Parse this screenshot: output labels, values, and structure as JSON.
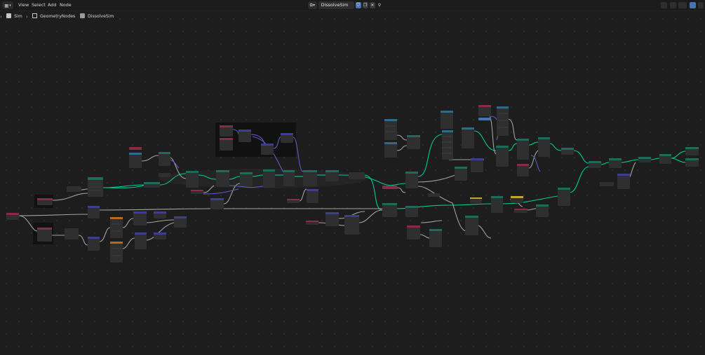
{
  "header": {
    "editor_type_icon": "node-editor-icon",
    "menus": [
      "View",
      "Select",
      "Add",
      "Node"
    ],
    "datablock": {
      "type_icon": "node-tree-icon",
      "name": "DissolveSim",
      "fake_user_icon": "shield-icon",
      "copy_icon": "duplicate-icon",
      "close_icon": "close-icon",
      "pin_icon": "pin-icon"
    },
    "right_icons": [
      "sidebar-toggle-icon",
      "overlay-icon",
      "snap-icon",
      "gizmo-icon",
      "view-options-icon"
    ]
  },
  "breadcrumb": [
    {
      "label": "Sim",
      "icon": "object-icon"
    },
    {
      "label": "GeometryNodes",
      "icon": "modifier-icon"
    },
    {
      "label": "DissolveSim",
      "icon": "node-tree-icon"
    }
  ],
  "colors": {
    "background": "#1d1d1d",
    "node_body": "#303030",
    "geometry_header": "#1e6b5a",
    "input_header": "#8a2a44",
    "vector_header": "#3d3e8c",
    "converter_header": "#2f6a8a",
    "attribute_header": "#7a3f8a",
    "geometry_link": "#00d6a3",
    "generic_link": "#a7a7a7",
    "vector_link": "#6363c7"
  }
}
